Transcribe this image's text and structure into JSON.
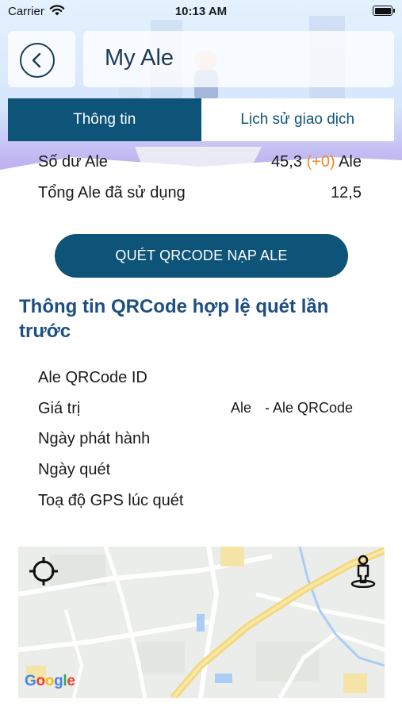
{
  "status_bar": {
    "carrier": "Carrier",
    "time": "10:13 AM"
  },
  "header": {
    "title": "My Ale"
  },
  "tabs": [
    {
      "label": "Thông tin",
      "active": true
    },
    {
      "label": "Lịch sử giao dịch",
      "active": false
    }
  ],
  "balance": {
    "label": "Số dư Ale",
    "amount": "45,3",
    "change": "(+0)",
    "unit": "Ale"
  },
  "used": {
    "label": "Tổng Ale đã sử dụng",
    "value": "12,5"
  },
  "scan_button": {
    "label": "QUÉT QRCODE NẠP ALE"
  },
  "last_scan": {
    "title": "Thông tin QRCode hợp lệ quét lần trước",
    "fields": [
      "Ale QRCode ID",
      "Giá trị",
      "Ngày phát hành",
      "Ngày quét",
      "Toạ độ GPS lúc quét"
    ],
    "value_unit": "Ale",
    "value_suffix": "- Ale QRCode"
  },
  "map": {
    "attribution": "Google"
  },
  "colors": {
    "primary": "#0d5478",
    "title_blue": "#1d4f80",
    "accent_orange": "#f08a24"
  },
  "icons": {
    "back": "chevron-left-icon",
    "wifi": "wifi-icon",
    "battery": "battery-icon",
    "locate": "crosshair-icon",
    "person": "street-view-person-icon"
  }
}
